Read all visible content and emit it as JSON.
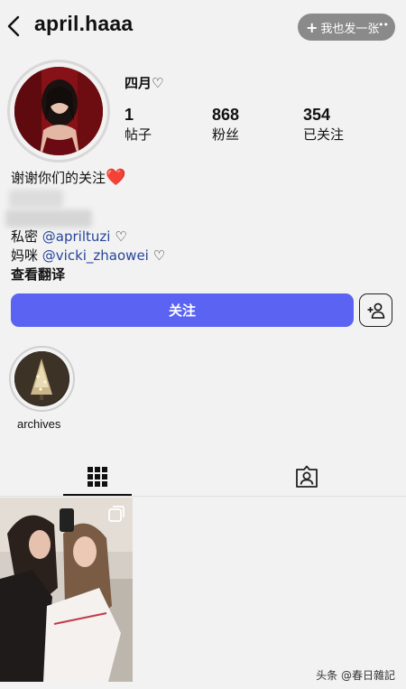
{
  "header": {
    "username": "april.haaa",
    "action_label": "我也发一张",
    "action_plus": "+",
    "action_dots": "••"
  },
  "profile": {
    "display_name": "四月♡",
    "stats": [
      {
        "value": "1",
        "label": "帖子"
      },
      {
        "value": "868",
        "label": "粉丝"
      },
      {
        "value": "354",
        "label": "已关注"
      }
    ],
    "bio_line": "谢谢你们的关注",
    "bio_emoji": "❤️",
    "links": [
      {
        "prefix": "私密 ",
        "handle": "@apriltuzi",
        "suffix": " ♡"
      },
      {
        "prefix": "妈咪 ",
        "handle": "@vicki_zhaowei",
        "suffix": " ♡"
      }
    ],
    "translate_label": "查看翻译"
  },
  "actions": {
    "follow_label": "关注"
  },
  "highlights": [
    {
      "label": "archives"
    }
  ],
  "tabs": [
    {
      "icon": "grid-icon",
      "active": true
    },
    {
      "icon": "tagged-icon",
      "active": false
    }
  ],
  "watermark": "头条 @春日雜記",
  "colors": {
    "follow_button": "#5a63f2",
    "link": "#26459a",
    "heart": "#e0162b"
  }
}
